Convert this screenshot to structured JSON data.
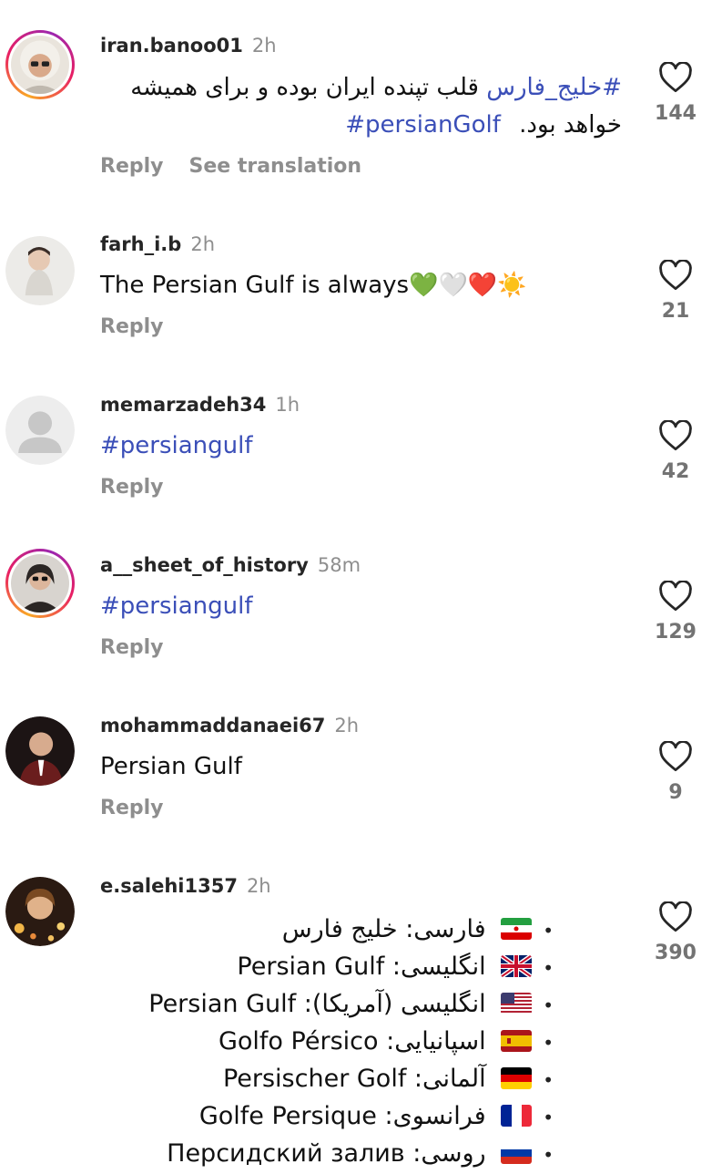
{
  "comments": [
    {
      "user": "iran.banoo01",
      "time": "2h",
      "line1_hashtag": "#خلیج_فارس",
      "line1_text": "قلب تپنده ایران بوده و برای همیشه",
      "line2_text": "خواهد بود.",
      "line2_hashtag": "persianGolf#",
      "reply": "Reply",
      "translate": "See translation",
      "likes": "144"
    },
    {
      "user": "farh_i.b",
      "time": "2h",
      "text": "The Persian Gulf is always💚🤍❤️☀️",
      "reply": "Reply",
      "likes": "21"
    },
    {
      "user": "memarzadeh34",
      "time": "1h",
      "text": "#persiangulf",
      "reply": "Reply",
      "likes": "42"
    },
    {
      "user": "a__sheet_of_history",
      "time": "58m",
      "text": "#persiangulf",
      "reply": "Reply",
      "likes": "129"
    },
    {
      "user": "mohammaddanaei67",
      "time": "2h",
      "text": "Persian Gulf",
      "reply": "Reply",
      "likes": "9"
    },
    {
      "user": "e.salehi1357",
      "time": "2h",
      "likes": "390",
      "list": [
        {
          "flag": "iran-flag",
          "label": "فارسی:",
          "value": "خلیج فارس"
        },
        {
          "flag": "uk-flag",
          "label": "انگلیسی:",
          "value": "Persian Gulf"
        },
        {
          "flag": "us-flag",
          "label": "انگلیسی (آمریکا):",
          "value": "Persian Gulf"
        },
        {
          "flag": "spain-flag",
          "label": "اسپانیایی:",
          "value": "Golfo Pérsico"
        },
        {
          "flag": "germany-flag",
          "label": "آلمانی:",
          "value": "Persischer Golf"
        },
        {
          "flag": "france-flag",
          "label": "فرانسوی:",
          "value": "Golfe Persique"
        },
        {
          "flag": "russia-flag",
          "label": "روسی:",
          "value": "Персидский залив"
        }
      ]
    }
  ],
  "colors": {
    "hashtag": "#3b4fb8",
    "muted": "#8e8e8e",
    "ring": "#e91e63"
  }
}
